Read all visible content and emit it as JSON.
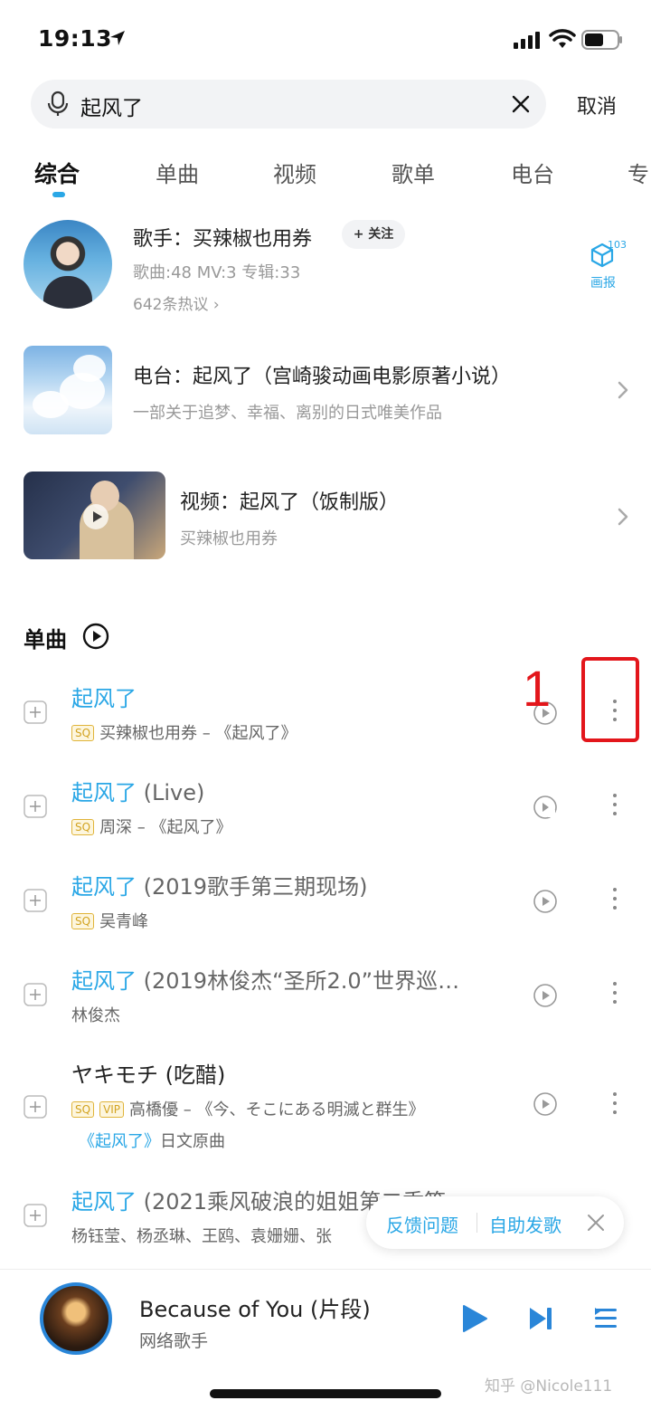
{
  "status_bar": {
    "time": "19:13"
  },
  "search": {
    "query": "起风了",
    "cancel_label": "取消"
  },
  "tabs": [
    {
      "label": "综合",
      "active": true
    },
    {
      "label": "单曲"
    },
    {
      "label": "视频"
    },
    {
      "label": "歌单"
    },
    {
      "label": "电台"
    },
    {
      "label": "专"
    }
  ],
  "singer": {
    "title": "歌手：买辣椒也用券",
    "follow_label": "+ 关注",
    "stats": "歌曲:48   MV:3   专辑:33",
    "hot": "642条热议 ›",
    "poster_count": "103",
    "poster_label": "画报"
  },
  "radio": {
    "title": "电台：起风了（宫崎骏动画电影原著小说）",
    "subtitle": "一部关于追梦、幸福、离别的日式唯美作品"
  },
  "video": {
    "title": "视频：起风了（饭制版）",
    "subtitle": "买辣椒也用券"
  },
  "songs_section": {
    "title": "单曲"
  },
  "songs": [
    {
      "title_main": "起风了",
      "title_extra": "",
      "badges": [
        "SQ"
      ],
      "meta": "买辣椒也用券 – 《起风了》"
    },
    {
      "title_main": "起风了",
      "title_extra": " (Live)",
      "badges": [
        "SQ"
      ],
      "meta": "周深 – 《起风了》"
    },
    {
      "title_main": "起风了",
      "title_extra": " (2019歌手第三期现场)",
      "badges": [
        "SQ"
      ],
      "meta": "吴青峰"
    },
    {
      "title_main": "起风了",
      "title_extra": " (2019林俊杰“圣所2.0”世界巡…",
      "badges": [],
      "meta": "林俊杰"
    },
    {
      "title_main": "ヤキモチ (吃醋)",
      "title_extra": "",
      "badges": [
        "SQ",
        "VIP"
      ],
      "meta": "高橋優 – 《今、そこにある明滅と群生》",
      "source_blue": "《起风了》",
      "source_rest": "日文原曲"
    },
    {
      "title_main": "起风了",
      "title_extra": " (2021乘风破浪的姐姐第二季等",
      "badges": [],
      "meta": "杨钰莹、杨丞琳、王鸥、袁姗姗、张"
    }
  ],
  "annotation": {
    "number": "1"
  },
  "feedback": {
    "report_label": "反馈问题",
    "publish_label": "自助发歌"
  },
  "player": {
    "title": "Because of You (片段)",
    "artist": "网络歌手"
  },
  "watermark": "知乎 @Nicole111",
  "colors": {
    "accent": "#2aa7e6",
    "annotation": "#e3161b",
    "badge": "#d2a321"
  }
}
